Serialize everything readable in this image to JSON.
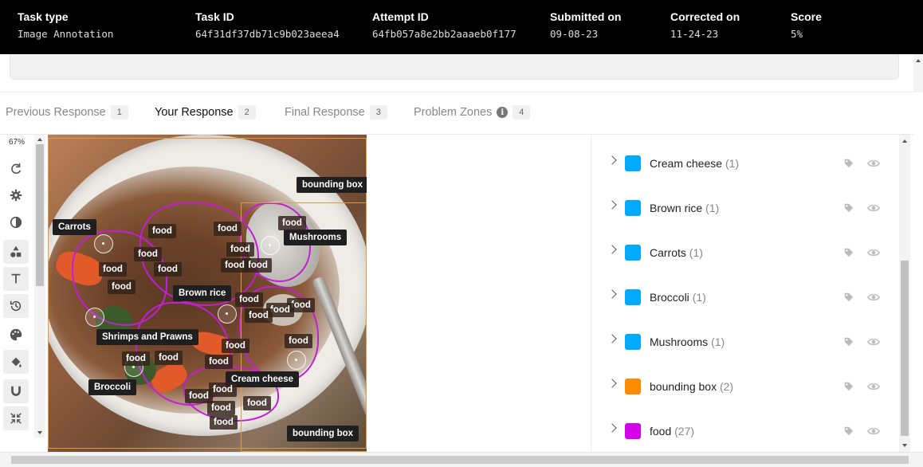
{
  "header": {
    "columns": [
      {
        "label": "Task type",
        "value": "Image Annotation"
      },
      {
        "label": "Task ID",
        "value": "64f31df37db71c9b023aeea4"
      },
      {
        "label": "Attempt ID",
        "value": "64fb057a8e2bb2aaaeb0f177"
      },
      {
        "label": "Submitted on",
        "value": "09-08-23"
      },
      {
        "label": "Corrected on",
        "value": "11-24-23"
      },
      {
        "label": "Score",
        "value": "5%"
      }
    ]
  },
  "tabs": [
    {
      "label": "Previous Response",
      "badge": "1",
      "active": false
    },
    {
      "label": "Your Response",
      "badge": "2",
      "active": true
    },
    {
      "label": "Final Response",
      "badge": "3",
      "active": false
    },
    {
      "label": "Problem Zones",
      "badge": "4",
      "active": false,
      "info_icon": "info-icon"
    }
  ],
  "toolbar": {
    "zoom": "67%",
    "tools": [
      "refresh-icon",
      "gear-icon",
      "contrast-icon",
      "shapes-icon",
      "text-icon",
      "history-icon",
      "palette-icon",
      "fill-icon",
      "magnet-icon",
      "shrink-icon"
    ]
  },
  "canvas": {
    "labels": {
      "carrots": "Carrots",
      "mushrooms": "Mushrooms",
      "brown_rice": "Brown rice",
      "shrimps": "Shrimps and Prawns",
      "broccoli": "Broccoli",
      "cream_cheese": "Cream cheese",
      "bbox_top": "bounding box",
      "bbox_bottom": "bounding box",
      "food": "food"
    }
  },
  "classes": [
    {
      "name": "Cream cheese",
      "count": "(1)",
      "color": "#00aaff"
    },
    {
      "name": "Brown rice",
      "count": "(1)",
      "color": "#00aaff"
    },
    {
      "name": "Carrots",
      "count": "(1)",
      "color": "#00aaff"
    },
    {
      "name": "Broccoli",
      "count": "(1)",
      "color": "#00aaff"
    },
    {
      "name": "Mushrooms",
      "count": "(1)",
      "color": "#00aaff"
    },
    {
      "name": "bounding box",
      "count": "(2)",
      "color": "#ff8c00"
    },
    {
      "name": "food",
      "count": "(27)",
      "color": "#d400e6"
    }
  ]
}
